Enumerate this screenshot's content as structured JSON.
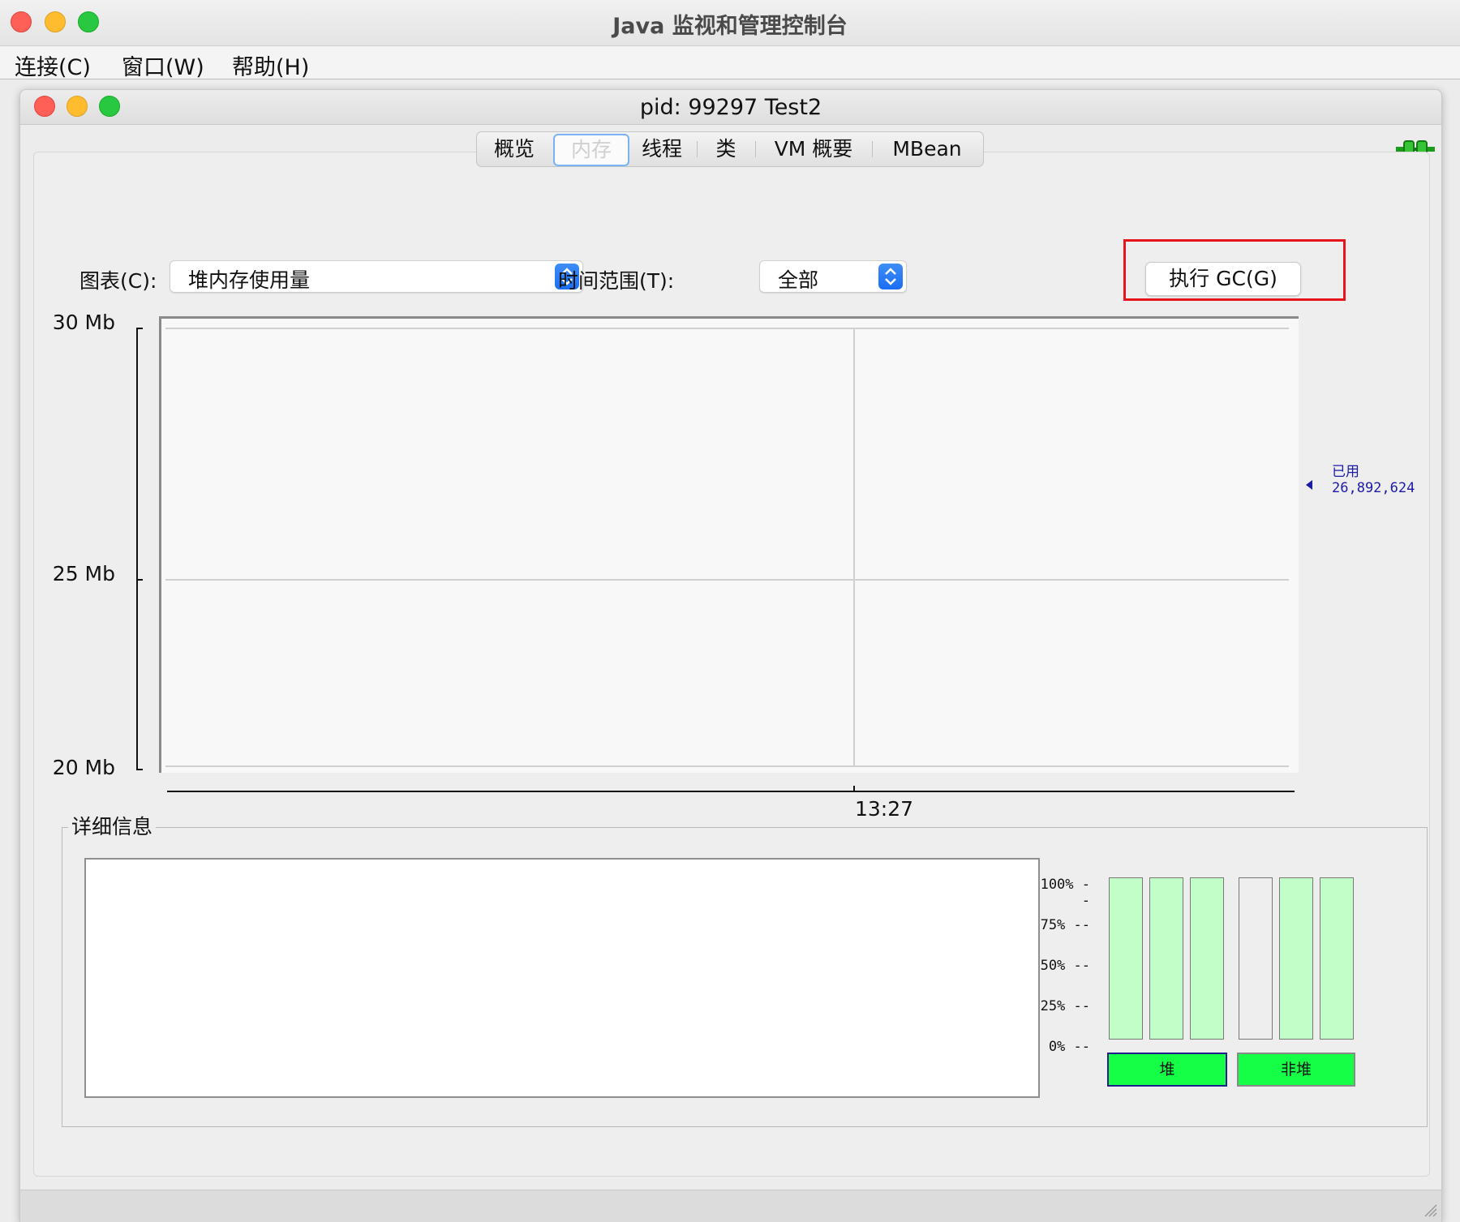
{
  "outer_window": {
    "title": "Java 监视和管理控制台",
    "menu": [
      "连接(C)",
      "窗口(W)",
      "帮助(H)"
    ]
  },
  "inner_window": {
    "title": "pid: 99297 Test2"
  },
  "tabs": [
    {
      "label": "概览",
      "active": false
    },
    {
      "label": "内存",
      "active": true
    },
    {
      "label": "线程",
      "active": false
    },
    {
      "label": "类",
      "active": false
    },
    {
      "label": "VM 概要",
      "active": false
    },
    {
      "label": "MBean",
      "active": false
    }
  ],
  "controls": {
    "chart_label": "图表(C):",
    "chart_value": "堆内存使用量",
    "time_range_label": "时间范围(T):",
    "time_range_value": "全部",
    "gc_button": "执行 GC(G)"
  },
  "memory_chart": {
    "y_ticks": [
      "30 Mb",
      "25 Mb",
      "20 Mb"
    ],
    "x_ticks": [
      "13:27"
    ],
    "used_label": "已用",
    "used_value": "26,892,624"
  },
  "details": {
    "legend": "详细信息",
    "pct_ticks": [
      "100% --",
      "75% --",
      "50% --",
      "25% --",
      "0% --"
    ],
    "pools": [
      {
        "label": "堆",
        "selected": true,
        "bars": [
          1.0,
          1.0,
          1.0
        ]
      },
      {
        "label": "非堆",
        "selected": false,
        "bars": [
          0.0,
          1.0,
          1.0
        ]
      }
    ]
  },
  "colors": {
    "tab_active_border": "#7ab3f5",
    "select_arrow": "#1a6ef2",
    "highlight_box": "#e8141c",
    "used_text": "#1b1ba8",
    "bar_fill": "#c2ffc8",
    "pool_button": "#14ff46"
  },
  "icons": {
    "connection": "connection-plug-icon",
    "dropdown": "chevron-updown-icon"
  }
}
